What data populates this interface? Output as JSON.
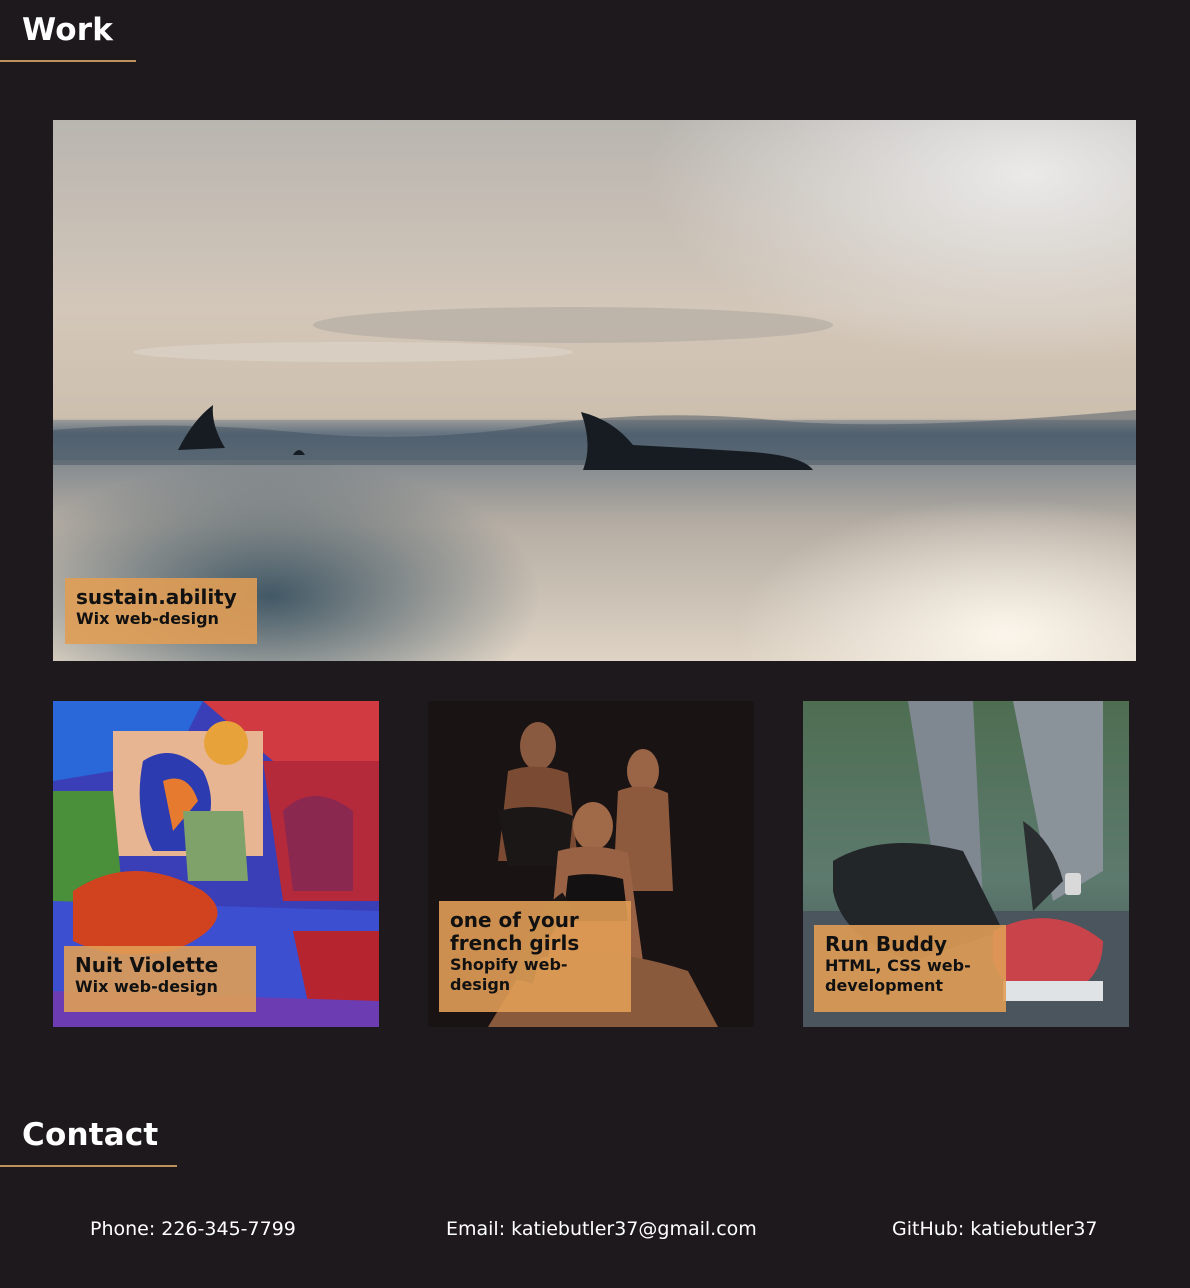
{
  "sections": {
    "work_heading": "Work",
    "contact_heading": "Contact"
  },
  "projects": [
    {
      "title": "sustain.ability",
      "subtitle": "Wix web-design",
      "image": "dolphins-at-sea-photo"
    },
    {
      "title": "Nuit Violette",
      "subtitle": "Wix web-design",
      "image": "colorful-abstract-painting"
    },
    {
      "title": "one of your french girls",
      "subtitle": "Shopify web-design",
      "image": "three-women-portrait-painting"
    },
    {
      "title": "Run Buddy",
      "subtitle": "HTML, CSS web-development",
      "image": "runner-tying-shoe-photo"
    }
  ],
  "contact": {
    "phone": "Phone: 226-345-7799",
    "email": "Email: katiebutler37@gmail.com",
    "github": "GitHub: katiebutler37"
  },
  "colors": {
    "background": "#1d191d",
    "accent": "#c0915a",
    "caption_bg": "#e09d55",
    "text": "#ffffff"
  }
}
